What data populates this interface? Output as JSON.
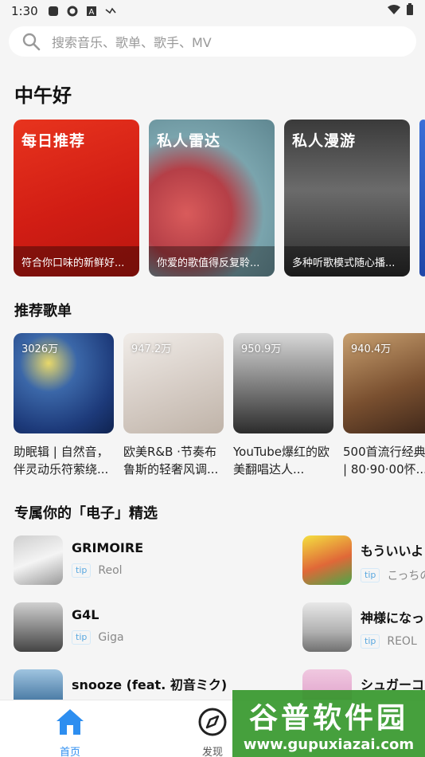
{
  "status_bar": {
    "time": "1:30"
  },
  "search": {
    "placeholder": "搜索音乐、歌单、歌手、MV"
  },
  "greeting": "中午好",
  "features": [
    {
      "title": "每日推荐",
      "subtitle": "符合你口味的新鲜好..."
    },
    {
      "title": "私人雷达",
      "subtitle": "你爱的歌值得反复聆..."
    },
    {
      "title": "私人漫游",
      "subtitle": "多种听歌模式随心播..."
    }
  ],
  "recommended": {
    "title": "推荐歌单",
    "items": [
      {
        "count": "3026万",
        "name": "助眠辑 | 自然音，伴灵动乐符萦绕..."
      },
      {
        "count": "947.2万",
        "name": "欧美R&B ·节奏布鲁斯的轻奢风调..."
      },
      {
        "count": "950.9万",
        "name": "YouTube爆红的欧美翻唱达人..."
      },
      {
        "count": "940.4万",
        "name": "500首流行经典歌 | 80·90·00怀..."
      }
    ]
  },
  "exclusive": {
    "title": "专属你的「电子」精选",
    "songs": [
      {
        "title": "GRIMOIRE",
        "tag": "tip",
        "artist": "Reol"
      },
      {
        "title": "G4L",
        "tag": "tip",
        "artist": "Giga"
      },
      {
        "title": "snooze (feat. 初音ミク)",
        "tag": "",
        "artist": ""
      },
      {
        "title": "もういいよ",
        "tag": "tip",
        "artist": "こっちの"
      },
      {
        "title": "神様になっ",
        "tag": "tip",
        "artist": "REOL"
      },
      {
        "title": "シュガーコ",
        "tag": "",
        "artist": ""
      }
    ]
  },
  "bottom_nav": {
    "items": [
      {
        "label": "首页",
        "icon": "home-icon",
        "active": true
      },
      {
        "label": "发现",
        "icon": "compass-icon",
        "active": false
      }
    ]
  },
  "watermark": {
    "title": "谷普软件园",
    "url": "www.gupuxiazai.com"
  },
  "colors": {
    "accent": "#2d8ef0",
    "tip": "#5aa8e0"
  }
}
